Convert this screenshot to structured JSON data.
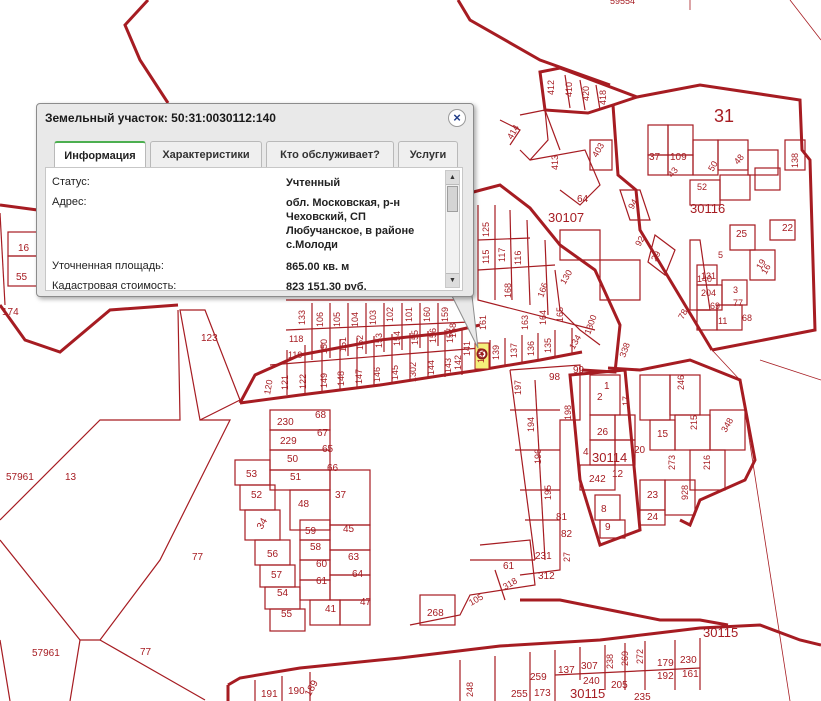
{
  "popup": {
    "title": "Земельный участок: 50:31:0030112:140",
    "close_label": "×",
    "tabs": [
      {
        "label": "Информация",
        "active": true
      },
      {
        "label": "Характеристики",
        "active": false
      },
      {
        "label": "Кто обслуживает?",
        "active": false
      },
      {
        "label": "Услуги",
        "active": false
      }
    ],
    "rows": [
      {
        "label": "Статус:",
        "value": "Учтенный"
      },
      {
        "label": "Адрес:",
        "value": "обл. Московская, р-н Чеховский, СП Любучанское, в районе с.Молоди"
      },
      {
        "label": "Уточненная площадь:",
        "value": "865.00 кв. м"
      },
      {
        "label": "Кадастровая стоимость:",
        "value": "823 151.30 руб."
      }
    ]
  },
  "map": {
    "colors": {
      "outline": "#a61c22",
      "highlight": "#f4ef7a",
      "marker": "#8b1a1a"
    },
    "labels": {
      "top_number": "59554",
      "block_31": "31",
      "block_30107": "30107",
      "block_30116": "30116",
      "block_30114": "30114",
      "block_30115_right": "30115",
      "block_30115_bottom": "30115",
      "region_57961_left": "57961",
      "region_13": "13",
      "region_57961_bottom": "57961",
      "region_77_mid": "77",
      "region_77_bottom": "77",
      "region_123": "123",
      "p412": "412",
      "p410": "410",
      "p420": "420",
      "p418": "418",
      "p414": "414",
      "p413": "413",
      "p403": "403",
      "p64": "64",
      "p130": "130",
      "p1300": "1300",
      "p37": "37",
      "p109": "109",
      "p43": "43",
      "p50": "50",
      "p52": "52",
      "p48": "48",
      "p138": "138",
      "p94": "94",
      "p92": "92",
      "p29": "29",
      "p25": "25",
      "p22": "22",
      "p19": "19",
      "p16": "16",
      "p5": "5",
      "p131": "131",
      "p140": "140",
      "p204": "204",
      "p3": "3",
      "p69": "69",
      "p77": "77",
      "p11": "11",
      "p68": "68",
      "p78": "78",
      "p338": "338",
      "p16l": "16",
      "p55l": "55",
      "p174": "174",
      "p125": "125",
      "p115": "115",
      "p117": "117",
      "p116": "116",
      "p168": "168",
      "p166": "166",
      "p161": "161",
      "p163": "163",
      "p164": "164",
      "p165": "165",
      "p133": "133",
      "p106": "106",
      "p105": "105",
      "p104": "104",
      "p103": "103",
      "p102": "102",
      "p101": "101",
      "p160": "160",
      "p159": "159",
      "p158": "158",
      "p118": "118",
      "p150": "150",
      "p151": "151",
      "p152": "152",
      "p153": "153",
      "p154": "154",
      "p155": "155",
      "p156": "156",
      "p157": "157",
      "p119": "119",
      "p139": "139",
      "p137": "137",
      "p136": "136",
      "p135": "135",
      "p134": "134",
      "p120": "120",
      "p121": "121",
      "p122": "122",
      "p149": "149",
      "p148": "148",
      "p147": "147",
      "p146": "146",
      "p145": "145",
      "p1302": "1302",
      "p144": "144",
      "p143": "143",
      "p142": "142",
      "p141": "141",
      "p140b": "140",
      "p230": "230",
      "p68b": "68",
      "p229": "229",
      "p67": "67",
      "p50b": "50",
      "p65": "65",
      "p51": "51",
      "p66": "66",
      "p53": "53",
      "p52b": "52",
      "p48b": "48",
      "p37b": "37",
      "p34": "34",
      "p59": "59",
      "p45": "45",
      "p58": "58",
      "p56": "56",
      "p60": "60",
      "p63": "63",
      "p57": "57",
      "p61": "61",
      "p64b": "64",
      "p54": "54",
      "p55b": "55",
      "p41": "41",
      "p47": "47",
      "p197": "197",
      "p98": "98",
      "p99": "99",
      "p194": "194",
      "p196": "196",
      "p195": "195",
      "p81": "81",
      "p82": "82",
      "p27": "27",
      "p231": "231",
      "p312": "312",
      "p61b": "61",
      "p318": "318",
      "p105b": "105",
      "p268": "268",
      "p1": "1",
      "p198": "198",
      "p2": "2",
      "p17": "17",
      "p26": "26",
      "p4": "4",
      "p20": "20",
      "p242": "242",
      "p12": "12",
      "p8": "8",
      "p9": "9",
      "p23": "23",
      "p24": "24",
      "p246": "246",
      "p215": "215",
      "p15": "15",
      "p348": "348",
      "p273": "273",
      "p216": "216",
      "p928": "928",
      "p191": "191",
      "p190": "190",
      "p189": "189",
      "p248": "248",
      "p259": "259",
      "p255": "255",
      "p173": "173",
      "p137b": "137",
      "p307": "307",
      "p240": "240",
      "p238": "238",
      "p269": "269",
      "p272": "272",
      "p205": "205",
      "p179": "179",
      "p230b": "230",
      "p192": "192",
      "p161b": "161",
      "p235": "235"
    }
  }
}
